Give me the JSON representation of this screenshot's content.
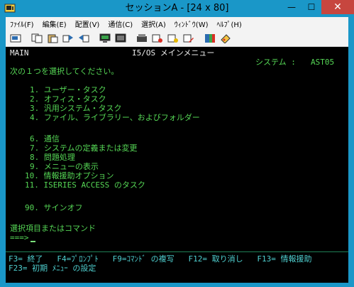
{
  "window": {
    "title": "セッションA - [24 x 80]"
  },
  "menubar": [
    "ﾌｧｲﾙ(F)",
    "編集(E)",
    "配置(V)",
    "通信(C)",
    "選択(A)",
    "ｳｨﾝﾄﾞｳ(W)",
    "ﾍﾙﾌﾟ(H)"
  ],
  "toolbar": [
    "print-icon",
    "copy-icon",
    "paste-icon",
    "send-icon",
    "receive-icon",
    "display-icon",
    "keyboard-icon",
    "macro-record-icon",
    "macro-play-icon",
    "macro-stop-icon",
    "macro-edit-icon",
    "color-icon",
    "help-icon"
  ],
  "screen": {
    "menu_id": "MAIN",
    "heading": "I5/OS メインメニュー",
    "system_label": "システム :",
    "system_name": "AST05",
    "prompt": "次の１つを選択してください。",
    "options": [
      "1. ユーザー・タスク",
      "2. オフィス・タスク",
      "3. 汎用システム・タスク",
      "4. ファイル、ライブラリー、およびフォルダー",
      "6. 通信",
      "7. システムの定義または変更",
      "8. 問題処理",
      "9. メニューの表示",
      "10. 情報援助オプション",
      "11. ISERIES ACCESS のタスク",
      "90. サインオフ"
    ],
    "command_label": "選択項目またはコマンド",
    "command_prompt": "===>",
    "fkeys_line1": "F3= 終了   F4=ﾌﾟﾛﾝﾌﾟﾄ   F9=ｺﾏﾝﾄﾞ の複写   F12= 取り消し   F13= 情報援助",
    "fkeys_line2": "F23= 初期 ﾒﾆｭｰ の設定"
  }
}
